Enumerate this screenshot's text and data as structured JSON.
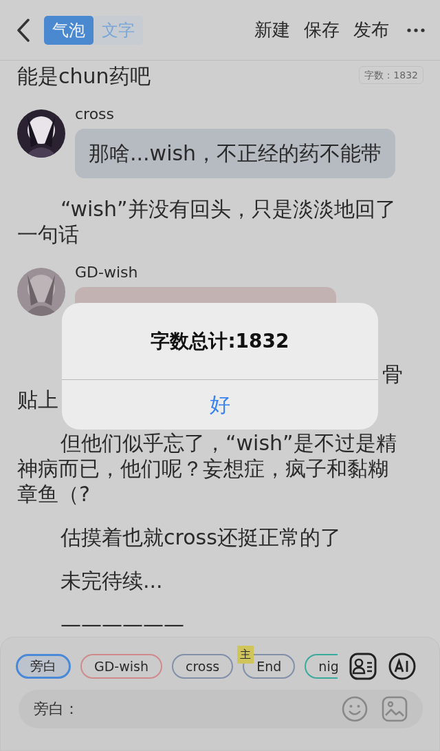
{
  "header": {
    "tabs": [
      {
        "label": "气泡",
        "selected": true
      },
      {
        "label": "文字",
        "selected": false
      }
    ],
    "actions": [
      "新建",
      "保存",
      "发布"
    ]
  },
  "word_count_badge": "字数：1832",
  "content": [
    {
      "kind": "line",
      "text": "能是chun药吧"
    },
    {
      "kind": "message",
      "name": "cross",
      "text": "那啥...wish，不正经的药不能带"
    },
    {
      "kind": "paragraph",
      "lines": [
        "“wish”并没有回头，只是淡淡地回了",
        "一句话"
      ]
    },
    {
      "kind": "message",
      "name": "GD-wish"
    },
    {
      "kind": "occluded",
      "line_end": "骨",
      "line_start": "贴上"
    },
    {
      "kind": "paragraph",
      "lines": [
        "但他们似乎忘了，“wish”是不过是精",
        "神病而已，他们呢？妄想症，疯子和黏糊",
        "章鱼（?"
      ]
    },
    {
      "kind": "paragraph",
      "lines": [
        "估摸着也就cross还挺正常的了"
      ]
    },
    {
      "kind": "paragraph",
      "lines": [
        "未完待续..."
      ]
    },
    {
      "kind": "paragraph",
      "lines": [
        "——————"
      ]
    }
  ],
  "alert": {
    "title": "字数总计:1832",
    "button": "好"
  },
  "roles": [
    {
      "label": "旁白",
      "selected": true,
      "color": "#4a88d8"
    },
    {
      "label": "GD-wish",
      "selected": false,
      "color": "#d08a8a"
    },
    {
      "label": "cross",
      "selected": false,
      "color": "#8090a8"
    },
    {
      "label": "End",
      "selected": false,
      "color": "#8090a8",
      "badge": "主"
    },
    {
      "label": "nig",
      "selected": false,
      "color": "#3aaa9a"
    }
  ],
  "input": {
    "label": "旁白："
  }
}
